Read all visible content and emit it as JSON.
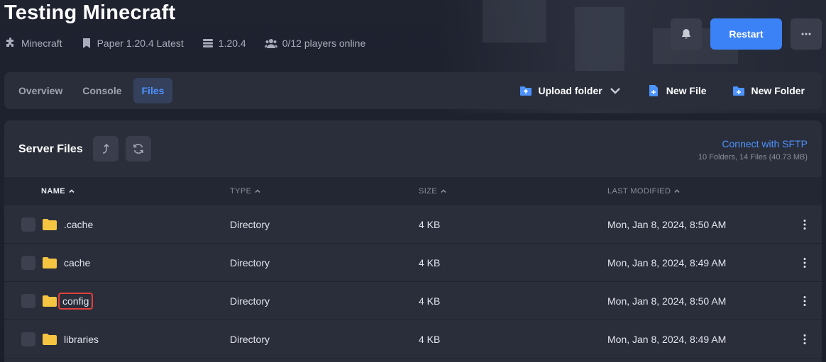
{
  "server": {
    "title": "Testing Minecraft",
    "meta": {
      "game": "Minecraft",
      "software": "Paper 1.20.4 Latest",
      "version": "1.20.4",
      "players": "0/12 players online"
    }
  },
  "actions": {
    "restart_label": "Restart"
  },
  "tabs": [
    {
      "label": "Overview",
      "active": false
    },
    {
      "label": "Console",
      "active": false
    },
    {
      "label": "Files",
      "active": true
    }
  ],
  "tab_actions": {
    "upload_folder": "Upload folder",
    "new_file": "New File",
    "new_folder": "New Folder"
  },
  "files_panel": {
    "title": "Server Files",
    "sftp_link": "Connect with SFTP",
    "counts": "10 Folders, 14 Files (40.73 MB)",
    "columns": {
      "name": "NAME",
      "type": "TYPE",
      "size": "SIZE",
      "modified": "LAST MODIFIED"
    },
    "rows": [
      {
        "name": ".cache",
        "type": "Directory",
        "size": "4 KB",
        "modified": "Mon, Jan 8, 2024, 8:50 AM"
      },
      {
        "name": "cache",
        "type": "Directory",
        "size": "4 KB",
        "modified": "Mon, Jan 8, 2024, 8:49 AM"
      },
      {
        "name": "config",
        "type": "Directory",
        "size": "4 KB",
        "modified": "Mon, Jan 8, 2024, 8:50 AM"
      },
      {
        "name": "libraries",
        "type": "Directory",
        "size": "4 KB",
        "modified": "Mon, Jan 8, 2024, 8:49 AM"
      }
    ]
  },
  "colors": {
    "accent": "#3b82f6",
    "folder": "#f5c542",
    "highlight": "#e0403a"
  }
}
